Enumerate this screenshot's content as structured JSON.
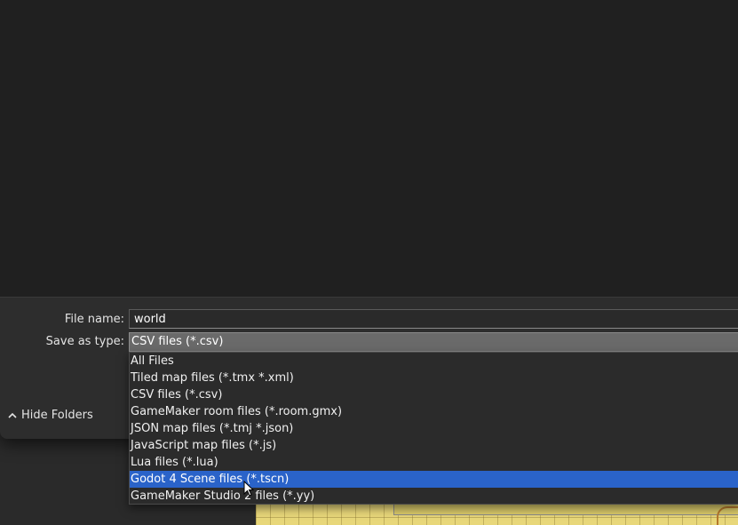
{
  "dialog": {
    "file_name_label": "File name:",
    "file_name_value": "world",
    "save_as_type_label": "Save as type:",
    "save_as_type_value": "CSV files (*.csv)",
    "hide_folders_label": "Hide Folders",
    "hide_folders_icon": "chevron-up-icon"
  },
  "dropdown": {
    "options": [
      "All Files",
      "Tiled map files (*.tmx *.xml)",
      "CSV files (*.csv)",
      "GameMaker room files (*.room.gmx)",
      "JSON map files (*.tmj *.json)",
      "JavaScript map files (*.js)",
      "Lua files (*.lua)",
      "Godot 4 Scene files (*.tscn)",
      "GameMaker Studio 2 files (*.yy)"
    ],
    "highlighted": "Godot 4 Scene files (*.tscn)"
  },
  "colors": {
    "highlight": "#2a63c9",
    "dialog_bg": "#202020",
    "footer_bg": "#2d2d2d",
    "select_bg": "#6a6a6a"
  }
}
